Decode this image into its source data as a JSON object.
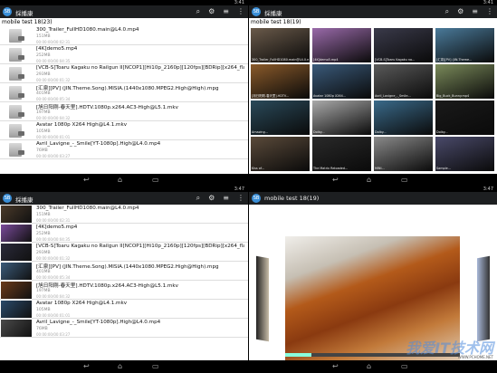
{
  "app": {
    "title": "採播康",
    "logo_text": "SB"
  },
  "status": {
    "time_q1": "3:41",
    "time_q2": "3:41",
    "time_q3": "3:47",
    "time_q4": "3:47"
  },
  "subtitle": "mobile test 18(23)",
  "subtitle_grid": "mobile test 18(19)",
  "subtitle_player": "mobile test 18(19)",
  "files": [
    {
      "name": "300_Trailer_FullHD1080.main@L4.0.mp4",
      "size": "151MB",
      "duration": "00:00:00/00:02:31"
    },
    {
      "name": "[4K]demo5.mp4",
      "size": "252MB",
      "duration": "00:00:00/00:04:35"
    },
    {
      "name": "[VCB-S]Toaru Kagaku no Railgun II[NCOP1][Hi10p_2160p][120fps][BDRip][x264_flac].mkv",
      "size": "293MB",
      "duration": "00:00:00/00:01:32"
    },
    {
      "name": "[汇泉][PV] (JIN.Theme.Song).MISIA.(1440x1080.MPEG2.High@High).mpg",
      "size": "401MB",
      "duration": "00:00:00/00:05:34"
    },
    {
      "name": "[旭日阳刚-春天里].HDTV.1080p.x264.AC3-High@L5.1.mkv",
      "size": "197MB",
      "duration": "00:00:00/00:04:32"
    },
    {
      "name": "Avatar 1080p X264 High@L4.1.mkv",
      "size": "105MB",
      "duration": "00:00:00/00:01:01"
    },
    {
      "name": "Avril_Lavigne_-_Smile[YT-1080p].High@L4.0.mp4",
      "size": "76MB",
      "duration": "00:00:00/00:03:27"
    }
  ],
  "grid_captions": [
    "300_Trailer_FullHD1080.main@L4.0.mp4",
    "[4K]demo5.mp4",
    "[VCB-S]Toaru Kagaku no...",
    "[汇泉][PV] (JIN.Theme...",
    "[旭日阳刚-春天里].HDTV...",
    "Avatar 1080p X264...",
    "Avril_Lavigne_-_Smile...",
    "Big_Buck_Bunny.mp4",
    "Amazing...",
    "Dolby...",
    "Dolby...",
    "Dolby...",
    "Kiss of...",
    "The Matrix Reloaded...",
    "MINI...",
    "Sample..."
  ],
  "player": {
    "overlay": "0:15 / [4K]demo5.mp4 High@L5.1 1080p"
  },
  "watermark": {
    "main": "我爱IT技术网",
    "sub": "WWW.PCHOME.NET"
  },
  "icons": {
    "search": "search-icon",
    "settings": "gear-icon",
    "sort": "sort-icon",
    "more": "overflow-menu-icon",
    "back": "back-icon",
    "home": "home-icon",
    "recents": "recents-icon"
  }
}
